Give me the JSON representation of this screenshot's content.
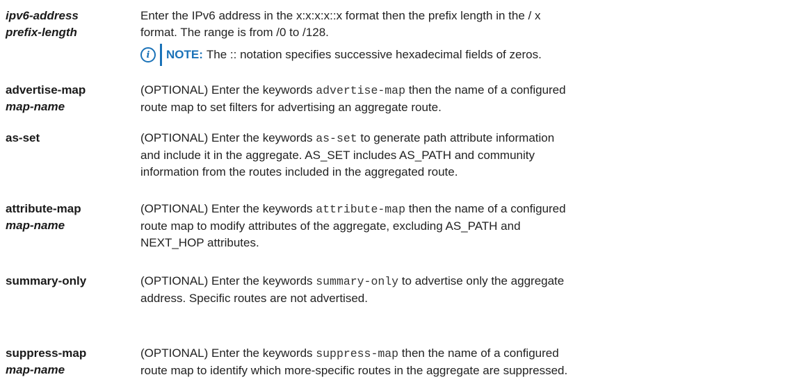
{
  "rows": [
    {
      "term": [
        "ipv6-address",
        "prefix-length"
      ],
      "term_style": [
        "italic",
        "italic"
      ],
      "desc": [
        [
          {
            "t": "Enter the IPv6 address in the x:x:x:x::x format then the prefix length in the / x"
          }
        ],
        [
          {
            "t": "format. The range is from /0 to /128."
          }
        ]
      ],
      "note": {
        "label": "NOTE:",
        "text": "The :: notation specifies successive hexadecimal fields of zeros."
      }
    },
    {
      "term": [
        "advertise-map",
        "map-name"
      ],
      "term_style": [
        "normal",
        "italic"
      ],
      "desc": [
        [
          {
            "t": "(OPTIONAL) Enter the keywords "
          },
          {
            "c": "advertise-map"
          },
          {
            "t": " then the name of a configured"
          }
        ],
        [
          {
            "t": "route map to set filters for advertising an aggregate route."
          }
        ]
      ]
    },
    {
      "term": [
        "as-set"
      ],
      "term_style": [
        "normal"
      ],
      "desc": [
        [
          {
            "t": "(OPTIONAL) Enter the keywords "
          },
          {
            "c": "as-set"
          },
          {
            "t": " to generate path attribute information"
          }
        ],
        [
          {
            "t": "and include it in the aggregate. AS_SET includes AS_PATH and community"
          }
        ],
        [
          {
            "t": "information from the routes included in the aggregated route."
          }
        ]
      ]
    },
    {
      "term": [
        "attribute-map",
        "map-name"
      ],
      "term_style": [
        "normal",
        "italic"
      ],
      "desc": [
        [
          {
            "t": "(OPTIONAL) Enter the keywords "
          },
          {
            "c": "attribute-map"
          },
          {
            "t": " then the name of a configured"
          }
        ],
        [
          {
            "t": "route map to modify attributes of the aggregate, excluding AS_PATH and"
          }
        ],
        [
          {
            "t": "NEXT_HOP attributes."
          }
        ]
      ]
    },
    {
      "term": [
        "summary-only"
      ],
      "term_style": [
        "normal"
      ],
      "desc": [
        [
          {
            "t": "(OPTIONAL) Enter the keywords "
          },
          {
            "c": "summary-only"
          },
          {
            "t": " to advertise only the aggregate"
          }
        ],
        [
          {
            "t": "address. Specific routes are not advertised."
          }
        ]
      ]
    },
    {
      "term": [
        "suppress-map",
        "map-name"
      ],
      "term_style": [
        "normal",
        "italic"
      ],
      "desc": [
        [
          {
            "t": "(OPTIONAL) Enter the keywords "
          },
          {
            "c": "suppress-map"
          },
          {
            "t": " then the name of a configured"
          }
        ],
        [
          {
            "t": "route map to identify which more-specific routes in the aggregate are suppressed."
          }
        ]
      ]
    }
  ]
}
